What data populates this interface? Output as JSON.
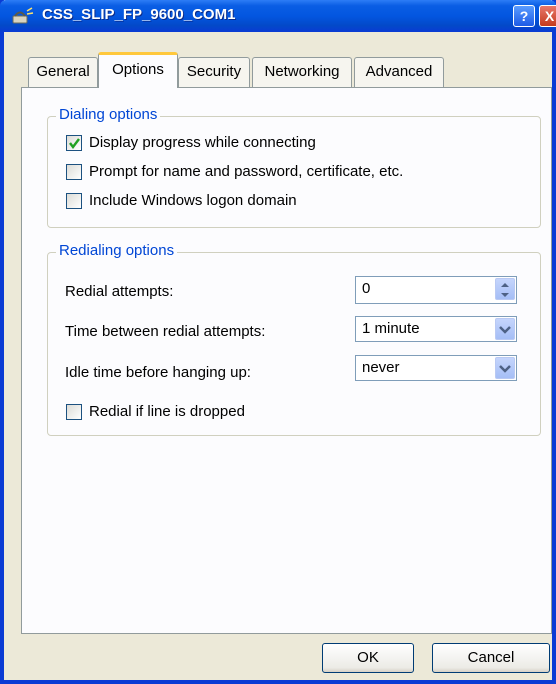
{
  "window": {
    "title": "CSS_SLIP_FP_9600_COM1",
    "help_label": "?",
    "close_label": "X"
  },
  "tabs": [
    {
      "label": "General"
    },
    {
      "label": "Options"
    },
    {
      "label": "Security"
    },
    {
      "label": "Networking"
    },
    {
      "label": "Advanced"
    }
  ],
  "dialing": {
    "legend": "Dialing options",
    "options": [
      {
        "label": "Display progress while connecting",
        "checked": true
      },
      {
        "label": "Prompt for name and password, certificate, etc.",
        "checked": false
      },
      {
        "label": "Include Windows logon domain",
        "checked": false
      }
    ]
  },
  "redialing": {
    "legend": "Redialing options",
    "attempts_label": "Redial attempts:",
    "attempts_value": "0",
    "time_label": "Time between redial attempts:",
    "time_value": "1 minute",
    "idle_label": "Idle time before hanging up:",
    "idle_value": "never",
    "redial_dropped_label": "Redial if line is dropped",
    "redial_dropped_checked": false
  },
  "buttons": {
    "ok": "OK",
    "cancel": "Cancel"
  },
  "colors": {
    "titlebar": "#0356e0",
    "legend_text": "#0046d5",
    "active_tab_accent": "#ffc83c",
    "dialog_bg": "#ece9d8"
  }
}
